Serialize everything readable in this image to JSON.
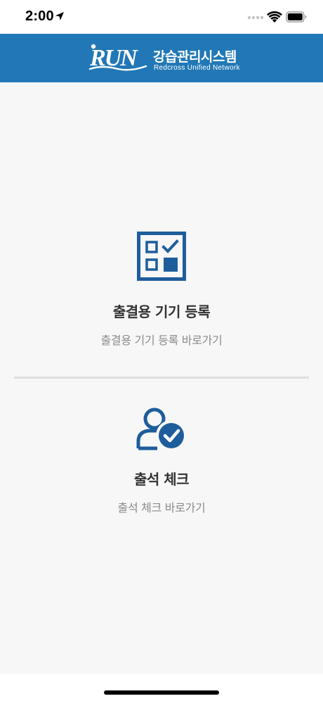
{
  "status_bar": {
    "time": "2:00",
    "icons": [
      "location-arrow-icon",
      "signal-dots-icon",
      "wifi-icon",
      "battery-icon"
    ]
  },
  "header": {
    "logo": "RUN",
    "title": "강습관리시스템",
    "subtitle": "Redcross Unified Network",
    "background_color": "#2278b6"
  },
  "menu": [
    {
      "icon": "checklist-icon",
      "title": "출결용 기기 등록",
      "subtitle": "출결용 기기 등록 바로가기"
    },
    {
      "icon": "user-check-icon",
      "title": "출석 체크",
      "subtitle": "출석 체크 바로가기"
    }
  ],
  "colors": {
    "accent": "#1e5d9c",
    "title_text": "#333333",
    "subtitle_text": "#8a8a8a",
    "background": "#f7f7f7"
  }
}
